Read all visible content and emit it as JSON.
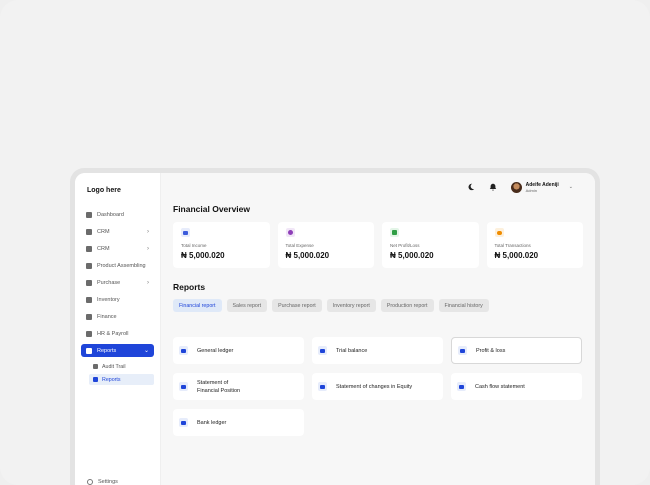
{
  "sidebar": {
    "logo": "Logo here",
    "items": [
      {
        "label": "Dashboard",
        "chevron": false
      },
      {
        "label": "CRM",
        "chevron": true
      },
      {
        "label": "CRM",
        "chevron": true
      },
      {
        "label": "Product Assembling",
        "chevron": false
      },
      {
        "label": "Purchase",
        "chevron": true
      },
      {
        "label": "Inventory",
        "chevron": false
      },
      {
        "label": "Finance",
        "chevron": false
      },
      {
        "label": "HR & Payroll",
        "chevron": false
      },
      {
        "label": "Reports",
        "chevron": true
      }
    ],
    "sub_items": [
      {
        "label": "Audit Trail"
      },
      {
        "label": "Reports"
      }
    ],
    "settings": "Settings"
  },
  "topbar": {
    "user_name": "Adeife Adeniji",
    "user_role": "Admin"
  },
  "overview": {
    "title": "Financial Overview",
    "cards": [
      {
        "label": "Total Income",
        "value": "₦ 5,000.020",
        "color": "#3b5bdb",
        "icon": "wallet-icon"
      },
      {
        "label": "Total Expense",
        "value": "₦ 5,000.020",
        "color": "#8e3fb8",
        "icon": "tag-icon"
      },
      {
        "label": "Net Profit/Loss",
        "value": "₦ 5,000.020",
        "color": "#2f9e44",
        "icon": "download-icon"
      },
      {
        "label": "Total Transactions",
        "value": "₦ 5,000.020",
        "color": "#f08c00",
        "icon": "coins-icon"
      }
    ]
  },
  "reports": {
    "title": "Reports",
    "tabs": [
      {
        "label": "Financial report",
        "active": true
      },
      {
        "label": "Sales report",
        "active": false
      },
      {
        "label": "Purchase report",
        "active": false
      },
      {
        "label": "Inventory report",
        "active": false
      },
      {
        "label": "Production report",
        "active": false
      },
      {
        "label": "Financial history",
        "active": false
      }
    ],
    "items": [
      {
        "label": "General ledger"
      },
      {
        "label": "Trial balance"
      },
      {
        "label": "Profit & loss"
      },
      {
        "label": "Statement of Financial Position"
      },
      {
        "label": "Statement of changes in Equity"
      },
      {
        "label": "Cash flow statement"
      },
      {
        "label": "Bank ledger"
      }
    ]
  }
}
